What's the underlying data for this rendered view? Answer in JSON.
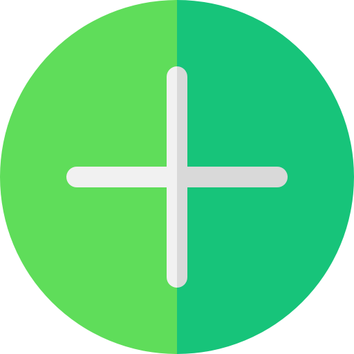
{
  "icon": {
    "name": "add-icon",
    "colors": {
      "circle_left": "#5fdd5a",
      "circle_right": "#17c47a",
      "bar_light": "#f1f1f1",
      "bar_shade": "#d9d9d9"
    }
  }
}
